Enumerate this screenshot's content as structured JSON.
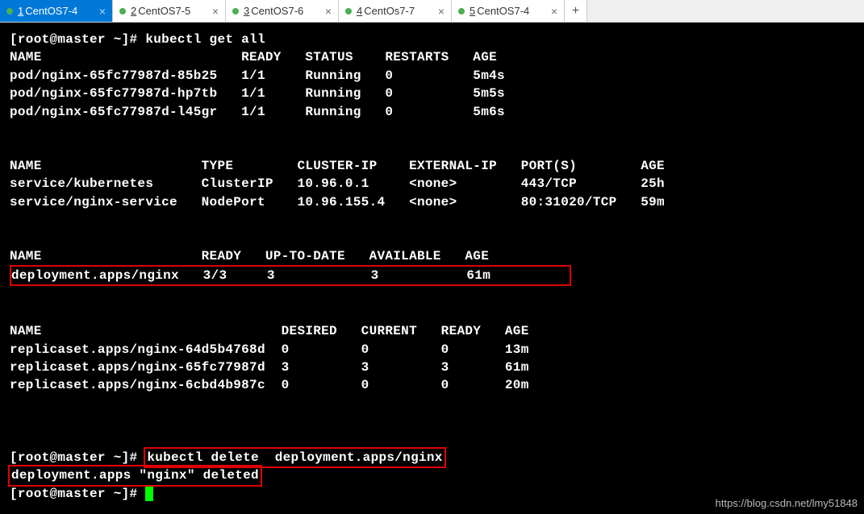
{
  "tabs": [
    {
      "num": "1",
      "label": "CentOS7-4",
      "active": true
    },
    {
      "num": "2",
      "label": "CentOS7-5",
      "active": false
    },
    {
      "num": "3",
      "label": "CentOS7-6",
      "active": false
    },
    {
      "num": "4",
      "label": "CentOs7-7",
      "active": false
    },
    {
      "num": "5",
      "label": "CentOS7-4",
      "active": false
    }
  ],
  "prompt": "[root@master ~]# ",
  "cmd1": "kubectl get all",
  "pods": {
    "header": "NAME                         READY   STATUS    RESTARTS   AGE",
    "rows": [
      "pod/nginx-65fc77987d-85b25   1/1     Running   0          5m4s",
      "pod/nginx-65fc77987d-hp7tb   1/1     Running   0          5m5s",
      "pod/nginx-65fc77987d-l45gr   1/1     Running   0          5m6s"
    ]
  },
  "services": {
    "header": "NAME                    TYPE        CLUSTER-IP    EXTERNAL-IP   PORT(S)        AGE",
    "rows": [
      "service/kubernetes      ClusterIP   10.96.0.1     <none>        443/TCP        25h",
      "service/nginx-service   NodePort    10.96.155.4   <none>        80:31020/TCP   59m"
    ]
  },
  "deployments": {
    "header": "NAME                    READY   UP-TO-DATE   AVAILABLE   AGE",
    "row": "deployment.apps/nginx   3/3     3            3           61m"
  },
  "replicasets": {
    "header": "NAME                              DESIRED   CURRENT   READY   AGE",
    "rows": [
      "replicaset.apps/nginx-64d5b4768d  0         0         0       13m",
      "replicaset.apps/nginx-65fc77987d  3         3         3       61m",
      "replicaset.apps/nginx-6cbd4b987c  0         0         0       20m"
    ]
  },
  "cmd2": "kubectl delete  deployment.apps/nginx",
  "deleted_msg": "deployment.apps \"nginx\" deleted",
  "watermark": "https://blog.csdn.net/lmy51848"
}
